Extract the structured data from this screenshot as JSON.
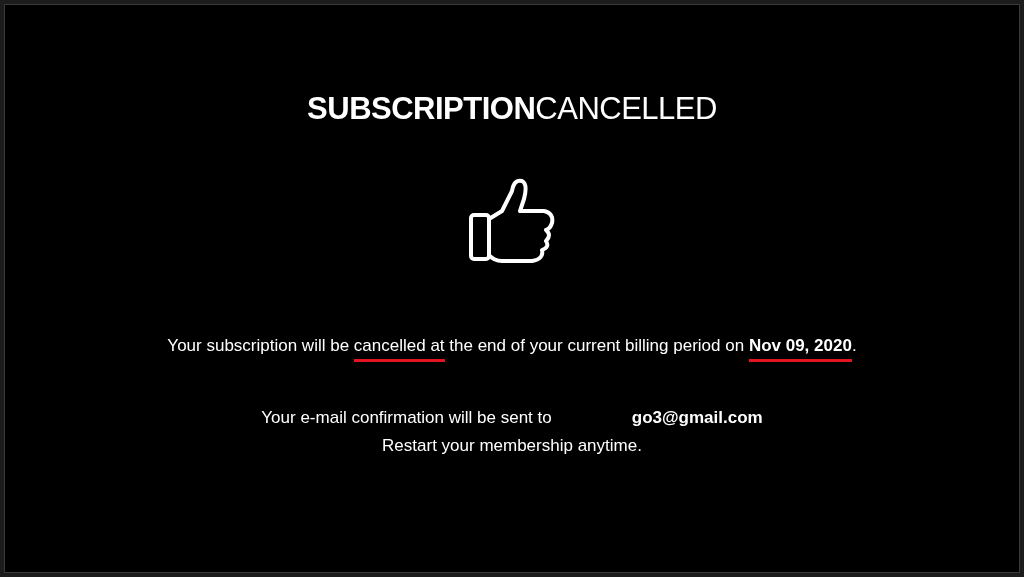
{
  "title": "**SUBSCRIPTION**CANCELLED",
  "message": [
    {
      "text": "Your subscription will be ",
      "bold": false,
      "underlined": false
    },
    {
      "text": "cancelled at",
      "bold": false,
      "underlined": true
    },
    {
      "text": " the end of your current billing period on ",
      "bold": false,
      "underlined": false
    },
    {
      "text": "Nov 09, 2020",
      "bold": true,
      "underlined": true
    },
    {
      "text": ".",
      "bold": false,
      "underlined": false
    }
  ],
  "confirmation": {
    "label": "Your e-mail confirmation will be sent to",
    "email": "go3@gmail.com"
  },
  "restart_note": "Restart your membership anytime."
}
